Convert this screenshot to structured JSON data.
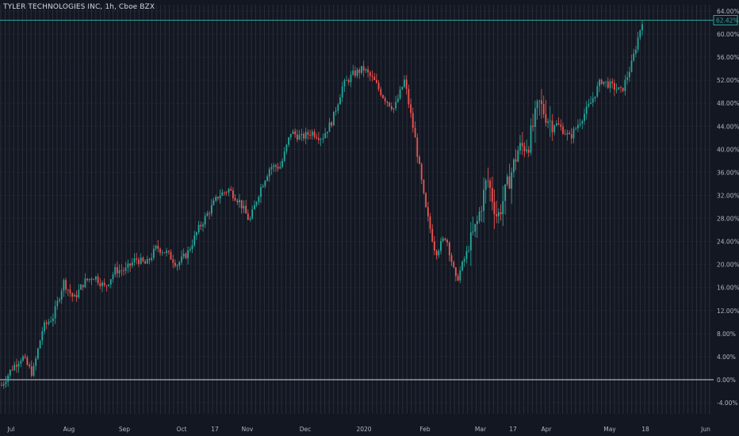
{
  "header": {
    "title": "TYLER TECHNOLOGIES INC, 1h, Cboe BZX"
  },
  "colors": {
    "background": "#131722",
    "grid": "#2a2e39",
    "up": "#26a69a",
    "down": "#ef5350",
    "axis_text": "#b2b5be",
    "zero_line": "#d1d4dc",
    "last_line": "#26a69a"
  },
  "chart_data": {
    "type": "candlestick",
    "title": "TYLER TECHNOLOGIES INC, 1h, Cboe BZX",
    "y_unit": "percent change",
    "ylim": [
      -6,
      66
    ],
    "y_ticks": [
      "64.00%",
      "60.00%",
      "56.00%",
      "52.00%",
      "48.00%",
      "44.00%",
      "40.00%",
      "36.00%",
      "32.00%",
      "28.00%",
      "24.00%",
      "20.00%",
      "16.00%",
      "12.00%",
      "8.00%",
      "4.00%",
      "0.00%",
      "-4.00%"
    ],
    "y_tick_values": [
      64,
      60,
      56,
      52,
      48,
      44,
      40,
      36,
      32,
      28,
      24,
      20,
      16,
      12,
      8,
      4,
      0,
      -4
    ],
    "x_labels": [
      "Jul",
      "Aug",
      "Sep",
      "Oct",
      "17",
      "Nov",
      "Dec",
      "2020",
      "Feb",
      "Mar",
      "17",
      "Apr",
      "May",
      "18",
      "Jun"
    ],
    "last_value": 62.42,
    "last_value_label": "62.42%",
    "zero_line": 0,
    "grid": true,
    "series_trend": [
      {
        "month": "Jul",
        "value": -1
      },
      {
        "month": "Jul",
        "value": 2
      },
      {
        "month": "Jul",
        "value": 4
      },
      {
        "month": "Aug",
        "value": 1
      },
      {
        "month": "Aug",
        "value": 9
      },
      {
        "month": "Aug",
        "value": 11
      },
      {
        "month": "Aug",
        "value": 17
      },
      {
        "month": "Aug",
        "value": 14
      },
      {
        "month": "Sep",
        "value": 17
      },
      {
        "month": "Sep",
        "value": 18
      },
      {
        "month": "Sep",
        "value": 16
      },
      {
        "month": "Sep",
        "value": 19
      },
      {
        "month": "Oct",
        "value": 19
      },
      {
        "month": "Oct",
        "value": 21
      },
      {
        "month": "Oct",
        "value": 20
      },
      {
        "month": "Oct",
        "value": 23
      },
      {
        "month": "Oct",
        "value": 22
      },
      {
        "month": "Oct",
        "value": 20
      },
      {
        "month": "Nov",
        "value": 22
      },
      {
        "month": "Nov",
        "value": 26
      },
      {
        "month": "Nov",
        "value": 29
      },
      {
        "month": "Nov",
        "value": 32
      },
      {
        "month": "Dec",
        "value": 33
      },
      {
        "month": "Dec",
        "value": 31
      },
      {
        "month": "Dec",
        "value": 27.5
      },
      {
        "month": "Dec",
        "value": 33
      },
      {
        "month": "Dec",
        "value": 37
      },
      {
        "month": "2020",
        "value": 37
      },
      {
        "month": "2020",
        "value": 43
      },
      {
        "month": "2020",
        "value": 42
      },
      {
        "month": "2020",
        "value": 43
      },
      {
        "month": "2020",
        "value": 42
      },
      {
        "month": "Feb",
        "value": 45
      },
      {
        "month": "Feb",
        "value": 51
      },
      {
        "month": "Feb",
        "value": 53
      },
      {
        "month": "Feb",
        "value": 54
      },
      {
        "month": "Feb",
        "value": 52
      },
      {
        "month": "Feb",
        "value": 49
      },
      {
        "month": "Mar",
        "value": 47
      },
      {
        "month": "Mar",
        "value": 52
      },
      {
        "month": "Mar",
        "value": 42
      },
      {
        "month": "Mar",
        "value": 30
      },
      {
        "month": "Mar",
        "value": 22
      },
      {
        "month": "Mar",
        "value": 25
      },
      {
        "month": "Mar",
        "value": 17
      },
      {
        "month": "Mar",
        "value": 22
      },
      {
        "month": "Mar",
        "value": 27
      },
      {
        "month": "Apr",
        "value": 35
      },
      {
        "month": "Apr",
        "value": 28
      },
      {
        "month": "Apr",
        "value": 34
      },
      {
        "month": "Apr",
        "value": 40
      },
      {
        "month": "Apr",
        "value": 41
      },
      {
        "month": "Apr",
        "value": 48
      },
      {
        "month": "Apr",
        "value": 45
      },
      {
        "month": "May",
        "value": 44
      },
      {
        "month": "May",
        "value": 42
      },
      {
        "month": "May",
        "value": 45
      },
      {
        "month": "May",
        "value": 48
      },
      {
        "month": "May",
        "value": 52
      },
      {
        "month": "May",
        "value": 51
      },
      {
        "month": "May",
        "value": 50
      },
      {
        "month": "18",
        "value": 55
      },
      {
        "month": "18",
        "value": 62.4
      }
    ]
  }
}
